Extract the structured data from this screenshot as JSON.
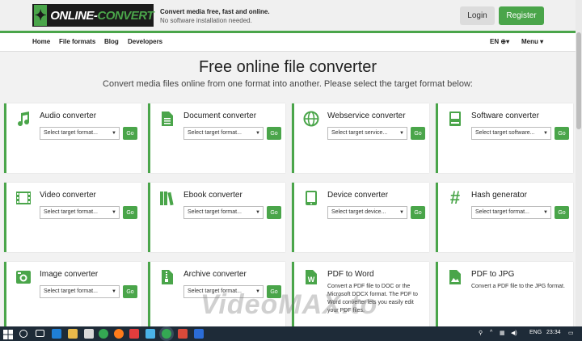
{
  "header": {
    "logo_text_1": "ONLINE-",
    "logo_text_2": "CONVERT",
    "tagline_1": "Convert media free, fast and online.",
    "tagline_2": "No software installation needed.",
    "login_label": "Login",
    "register_label": "Register"
  },
  "nav": {
    "home": "Home",
    "file_formats": "File formats",
    "blog": "Blog",
    "developers": "Developers",
    "language": "EN",
    "language_icon": "globe-icon",
    "menu": "Menu"
  },
  "hero": {
    "title": "Free online file converter",
    "subtitle": "Convert media files online from one format into another. Please select the target format below:"
  },
  "cards": [
    {
      "title": "Audio converter",
      "icon": "music-note-icon",
      "select": "Select target format...",
      "go": "Go"
    },
    {
      "title": "Document converter",
      "icon": "document-icon",
      "select": "Select target format...",
      "go": "Go"
    },
    {
      "title": "Webservice converter",
      "icon": "globe-icon",
      "select": "Select target service...",
      "go": "Go"
    },
    {
      "title": "Software converter",
      "icon": "computer-icon",
      "select": "Select target software...",
      "go": "Go"
    },
    {
      "title": "Video converter",
      "icon": "film-icon",
      "select": "Select target format...",
      "go": "Go"
    },
    {
      "title": "Ebook converter",
      "icon": "books-icon",
      "select": "Select target format...",
      "go": "Go"
    },
    {
      "title": "Device converter",
      "icon": "tablet-icon",
      "select": "Select target device...",
      "go": "Go"
    },
    {
      "title": "Hash generator",
      "icon": "hash-icon",
      "select": "Select target format...",
      "go": "Go"
    },
    {
      "title": "Image converter",
      "icon": "camera-icon",
      "select": "Select target format...",
      "go": "Go"
    },
    {
      "title": "Archive converter",
      "icon": "archive-icon",
      "select": "Select target format...",
      "go": "Go"
    },
    {
      "title": "PDF to Word",
      "icon": "word-file-icon",
      "desc": "Convert a PDF file to DOC or the Microsoft DOCX format. The PDF to Word converter lets you easily edit your PDF files."
    },
    {
      "title": "PDF to JPG",
      "icon": "image-file-icon",
      "desc": "Convert a PDF file to the JPG format."
    }
  ],
  "watermark": "VideoMAX.to",
  "taskbar": {
    "language": "ENG",
    "time": "23:34"
  },
  "colors": {
    "accent": "#4aa54a",
    "taskbar": "#1e2b38"
  }
}
